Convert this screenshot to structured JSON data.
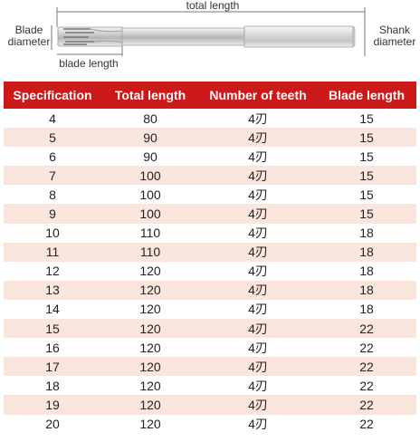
{
  "diagram": {
    "total_length_label": "total length",
    "blade_diameter_label": [
      "Blade",
      "diameter"
    ],
    "shank_diameter_label": [
      "Shank",
      "diameter"
    ],
    "blade_length_label": "blade length"
  },
  "table": {
    "headers": [
      "Specification",
      "Total length",
      "Number of teeth",
      "Blade length"
    ],
    "rows": [
      [
        "4",
        "80",
        "4刃",
        "15"
      ],
      [
        "5",
        "90",
        "4刃",
        "15"
      ],
      [
        "6",
        "90",
        "4刃",
        "15"
      ],
      [
        "7",
        "100",
        "4刃",
        "15"
      ],
      [
        "8",
        "100",
        "4刃",
        "15"
      ],
      [
        "9",
        "100",
        "4刃",
        "15"
      ],
      [
        "10",
        "110",
        "4刃",
        "18"
      ],
      [
        "11",
        "110",
        "4刃",
        "18"
      ],
      [
        "12",
        "120",
        "4刃",
        "18"
      ],
      [
        "13",
        "120",
        "4刃",
        "18"
      ],
      [
        "14",
        "120",
        "4刃",
        "18"
      ],
      [
        "15",
        "120",
        "4刃",
        "22"
      ],
      [
        "16",
        "120",
        "4刃",
        "22"
      ],
      [
        "17",
        "120",
        "4刃",
        "22"
      ],
      [
        "18",
        "120",
        "4刃",
        "22"
      ],
      [
        "19",
        "120",
        "4刃",
        "22"
      ],
      [
        "20",
        "120",
        "4刃",
        "22"
      ]
    ]
  },
  "colors": {
    "header_bg": "#cc1a1a",
    "alt_row_bg": "#fbe6dd"
  }
}
